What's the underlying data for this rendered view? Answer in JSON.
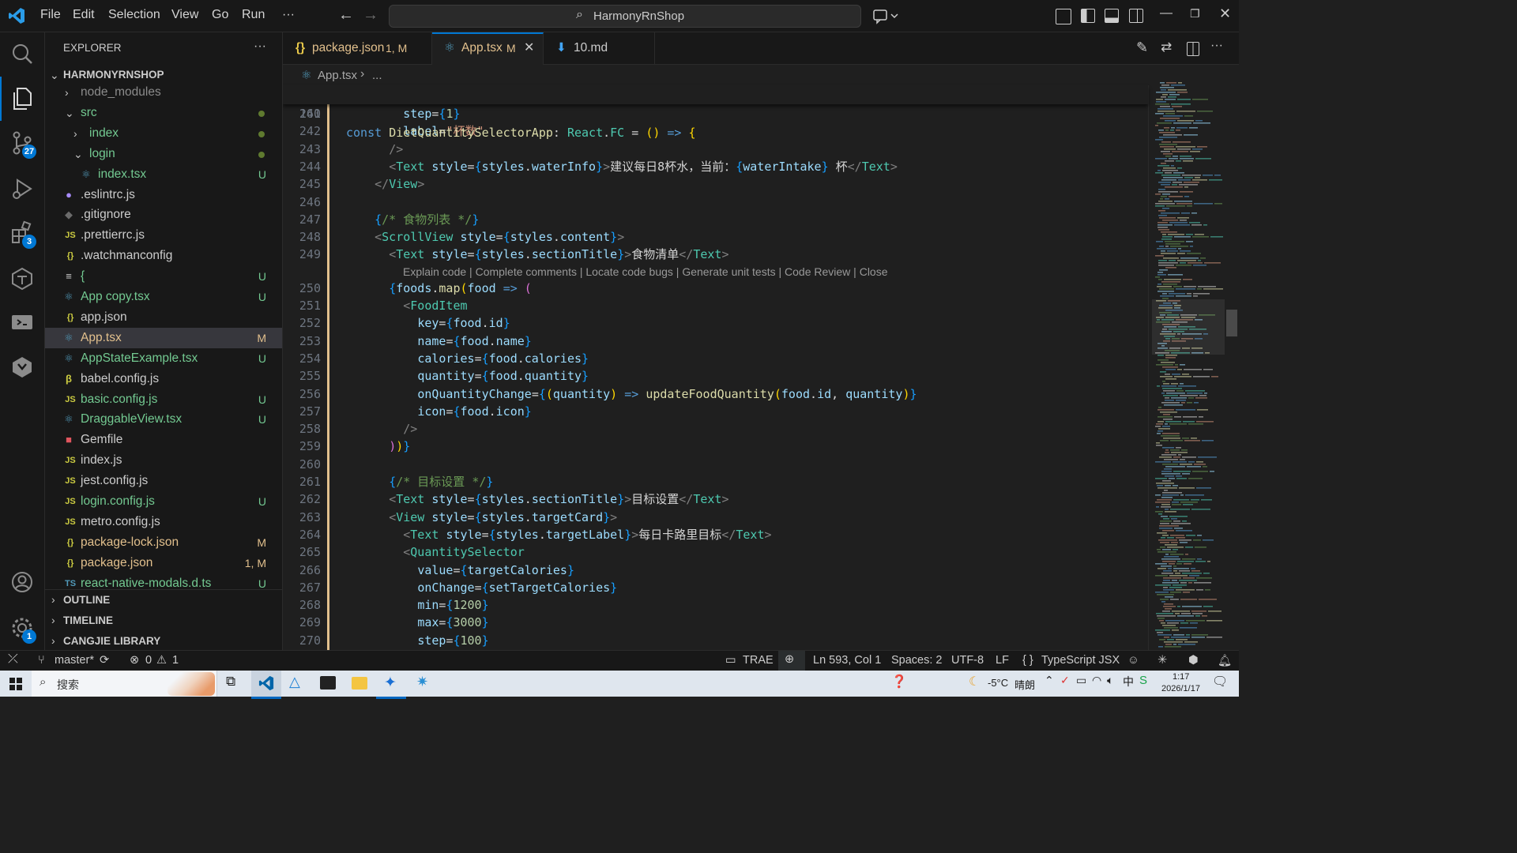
{
  "titlebar": {
    "menus": [
      "File",
      "Edit",
      "Selection",
      "View",
      "Go",
      "Run",
      "···"
    ],
    "search": "HarmonyRnShop"
  },
  "activity": {
    "items": [
      "files-icon",
      "search-icon",
      "source-control-icon",
      "run-debug-icon",
      "extensions-icon",
      "trae-icon",
      "remote-icon",
      "harmony-icon"
    ],
    "scm_badge": "27",
    "ext_badge": "3",
    "settings_badge": "1"
  },
  "sidebar": {
    "title": "EXPLORER",
    "more": "···",
    "root": "HARMONYRNSHOP",
    "rows": [
      {
        "name": "node_modules",
        "type": "folder-closed",
        "indent": 1,
        "color": "#8b8b8b",
        "status": "",
        "dot": false
      },
      {
        "name": "src",
        "type": "folder-open",
        "indent": 1,
        "color": "#73c991",
        "status": "",
        "dot": true
      },
      {
        "name": "index",
        "type": "folder-closed",
        "indent": 2,
        "color": "#73c991",
        "status": "",
        "dot": true
      },
      {
        "name": "login",
        "type": "folder-open",
        "indent": 2,
        "color": "#73c991",
        "status": "",
        "dot": true
      },
      {
        "name": "index.tsx",
        "type": "react",
        "indent": 3,
        "color": "#73c991",
        "status": "U",
        "dot": false
      },
      {
        "name": ".eslintrc.js",
        "type": "eslint",
        "indent": 1,
        "color": "#cccccc",
        "status": "",
        "dot": false
      },
      {
        "name": ".gitignore",
        "type": "git",
        "indent": 1,
        "color": "#cccccc",
        "status": "",
        "dot": false
      },
      {
        "name": ".prettierrc.js",
        "type": "js",
        "indent": 1,
        "color": "#cccccc",
        "status": "",
        "dot": false
      },
      {
        "name": ".watchmanconfig",
        "type": "json",
        "indent": 1,
        "color": "#cccccc",
        "status": "",
        "dot": false
      },
      {
        "name": "{",
        "type": "text",
        "indent": 1,
        "color": "#73c991",
        "status": "U",
        "dot": false
      },
      {
        "name": "App copy.tsx",
        "type": "react",
        "indent": 1,
        "color": "#73c991",
        "status": "U",
        "dot": false
      },
      {
        "name": "app.json",
        "type": "json",
        "indent": 1,
        "color": "#cccccc",
        "status": "",
        "dot": false
      },
      {
        "name": "App.tsx",
        "type": "react",
        "indent": 1,
        "color": "#e2c08d",
        "status": "M",
        "dot": false,
        "selected": true
      },
      {
        "name": "AppStateExample.tsx",
        "type": "react",
        "indent": 1,
        "color": "#73c991",
        "status": "U",
        "dot": false
      },
      {
        "name": "babel.config.js",
        "type": "babel",
        "indent": 1,
        "color": "#cccccc",
        "status": "",
        "dot": false
      },
      {
        "name": "basic.config.js",
        "type": "js",
        "indent": 1,
        "color": "#73c991",
        "status": "U",
        "dot": false
      },
      {
        "name": "DraggableView.tsx",
        "type": "react",
        "indent": 1,
        "color": "#73c991",
        "status": "U",
        "dot": false
      },
      {
        "name": "Gemfile",
        "type": "ruby",
        "indent": 1,
        "color": "#cccccc",
        "status": "",
        "dot": false
      },
      {
        "name": "index.js",
        "type": "js",
        "indent": 1,
        "color": "#cccccc",
        "status": "",
        "dot": false
      },
      {
        "name": "jest.config.js",
        "type": "js",
        "indent": 1,
        "color": "#cccccc",
        "status": "",
        "dot": false
      },
      {
        "name": "login.config.js",
        "type": "js",
        "indent": 1,
        "color": "#73c991",
        "status": "U",
        "dot": false
      },
      {
        "name": "metro.config.js",
        "type": "js",
        "indent": 1,
        "color": "#cccccc",
        "status": "",
        "dot": false
      },
      {
        "name": "package-lock.json",
        "type": "json",
        "indent": 1,
        "color": "#e2c08d",
        "status": "M",
        "dot": false
      },
      {
        "name": "package.json",
        "type": "json",
        "indent": 1,
        "color": "#e2c08d",
        "status": "1, M",
        "dot": false
      },
      {
        "name": "react-native-modals.d.ts",
        "type": "ts",
        "indent": 1,
        "color": "#73c991",
        "status": "U",
        "dot": false
      }
    ],
    "sections": [
      "OUTLINE",
      "TIMELINE",
      "CANGJIE LIBRARY"
    ]
  },
  "tabs": [
    {
      "icon": "{}",
      "label": "package.json",
      "suffix": "1, M",
      "active": false,
      "color": "#e2c08d"
    },
    {
      "icon": "⚛",
      "label": "App.tsx",
      "suffix": "M",
      "active": true,
      "color": "#e2c08d"
    },
    {
      "icon": "⬇",
      "label": "10.md",
      "suffix": "",
      "active": false,
      "color": "#cccccc"
    }
  ],
  "breadcrumb": {
    "file": "App.tsx",
    "rest": "..."
  },
  "sticky": {
    "line": "160",
    "code": "const DietQuantitySelectorApp: React.FC = () => {"
  },
  "codelens": "Explain code | Complete comments | Locate code bugs | Generate unit tests | Code Review | Close",
  "code_lines": [
    {
      "n": "241",
      "html": "        <span class='p'>step</span><span class='tx'>=</span><span class='b3'>{</span><span class='n'>1</span><span class='b3'>}</span>"
    },
    {
      "n": "242",
      "html": "        <span class='p'>label</span><span class='tx'>=</span><span class='s'>\"杯数\"</span>"
    },
    {
      "n": "243",
      "html": "      <span class='tg'>/&gt;</span>"
    },
    {
      "n": "244",
      "html": "      <span class='tg'>&lt;</span><span class='tn'>Text</span> <span class='p'>style</span><span class='tx'>=</span><span class='b3'>{</span><span class='p'>styles</span><span class='tx'>.</span><span class='p'>waterInfo</span><span class='b3'>}</span><span class='tg'>&gt;</span><span class='tx'>建议每日8杯水，当前：</span><span class='b3'>{</span><span class='p'>waterIntake</span><span class='b3'>}</span><span class='tx'> 杯</span><span class='tg'>&lt;/</span><span class='tn'>Text</span><span class='tg'>&gt;</span>"
    },
    {
      "n": "245",
      "html": "    <span class='tg'>&lt;/</span><span class='tn'>View</span><span class='tg'>&gt;</span>"
    },
    {
      "n": "246",
      "html": ""
    },
    {
      "n": "247",
      "html": "    <span class='b3'>{</span><span class='c'>/* 食物列表 */</span><span class='b3'>}</span>"
    },
    {
      "n": "248",
      "html": "    <span class='tg'>&lt;</span><span class='tn'>ScrollView</span> <span class='p'>style</span><span class='tx'>=</span><span class='b3'>{</span><span class='p'>styles</span><span class='tx'>.</span><span class='p'>content</span><span class='b3'>}</span><span class='tg'>&gt;</span>"
    },
    {
      "n": "249",
      "html": "      <span class='tg'>&lt;</span><span class='tn'>Text</span> <span class='p'>style</span><span class='tx'>=</span><span class='b3'>{</span><span class='p'>styles</span><span class='tx'>.</span><span class='p'>sectionTitle</span><span class='b3'>}</span><span class='tg'>&gt;</span><span class='tx'>食物清单</span><span class='tg'>&lt;/</span><span class='tn'>Text</span><span class='tg'>&gt;</span>"
    },
    {
      "n": "250",
      "html": "      <span class='b3'>{</span><span class='p'>foods</span><span class='tx'>.</span><span class='f'>map</span><span class='b1'>(</span><span class='p'>food</span> <span class='k'>=&gt;</span> <span class='b2'>(</span>"
    },
    {
      "n": "251",
      "html": "        <span class='tg'>&lt;</span><span class='tn'>FoodItem</span>"
    },
    {
      "n": "252",
      "html": "          <span class='p'>key</span><span class='tx'>=</span><span class='b3'>{</span><span class='p'>food</span><span class='tx'>.</span><span class='p'>id</span><span class='b3'>}</span>"
    },
    {
      "n": "253",
      "html": "          <span class='p'>name</span><span class='tx'>=</span><span class='b3'>{</span><span class='p'>food</span><span class='tx'>.</span><span class='p'>name</span><span class='b3'>}</span>"
    },
    {
      "n": "254",
      "html": "          <span class='p'>calories</span><span class='tx'>=</span><span class='b3'>{</span><span class='p'>food</span><span class='tx'>.</span><span class='p'>calories</span><span class='b3'>}</span>"
    },
    {
      "n": "255",
      "html": "          <span class='p'>quantity</span><span class='tx'>=</span><span class='b3'>{</span><span class='p'>food</span><span class='tx'>.</span><span class='p'>quantity</span><span class='b3'>}</span>"
    },
    {
      "n": "256",
      "html": "          <span class='p'>onQuantityChange</span><span class='tx'>=</span><span class='b3'>{</span><span class='b1'>(</span><span class='p'>quantity</span><span class='b1'>)</span> <span class='k'>=&gt;</span> <span class='f'>updateFoodQuantity</span><span class='b1'>(</span><span class='p'>food</span><span class='tx'>.</span><span class='p'>id</span><span class='tx'>, </span><span class='p'>quantity</span><span class='b1'>)</span><span class='b3'>}</span>"
    },
    {
      "n": "257",
      "html": "          <span class='p'>icon</span><span class='tx'>=</span><span class='b3'>{</span><span class='p'>food</span><span class='tx'>.</span><span class='p'>icon</span><span class='b3'>}</span>"
    },
    {
      "n": "258",
      "html": "        <span class='tg'>/&gt;</span>"
    },
    {
      "n": "259",
      "html": "      <span class='b2'>)</span><span class='b1'>)</span><span class='b3'>}</span>"
    },
    {
      "n": "260",
      "html": ""
    },
    {
      "n": "261",
      "html": "      <span class='b3'>{</span><span class='c'>/* 目标设置 */</span><span class='b3'>}</span>"
    },
    {
      "n": "262",
      "html": "      <span class='tg'>&lt;</span><span class='tn'>Text</span> <span class='p'>style</span><span class='tx'>=</span><span class='b3'>{</span><span class='p'>styles</span><span class='tx'>.</span><span class='p'>sectionTitle</span><span class='b3'>}</span><span class='tg'>&gt;</span><span class='tx'>目标设置</span><span class='tg'>&lt;/</span><span class='tn'>Text</span><span class='tg'>&gt;</span>"
    },
    {
      "n": "263",
      "html": "      <span class='tg'>&lt;</span><span class='tn'>View</span> <span class='p'>style</span><span class='tx'>=</span><span class='b3'>{</span><span class='p'>styles</span><span class='tx'>.</span><span class='p'>targetCard</span><span class='b3'>}</span><span class='tg'>&gt;</span>"
    },
    {
      "n": "264",
      "html": "        <span class='tg'>&lt;</span><span class='tn'>Text</span> <span class='p'>style</span><span class='tx'>=</span><span class='b3'>{</span><span class='p'>styles</span><span class='tx'>.</span><span class='p'>targetLabel</span><span class='b3'>}</span><span class='tg'>&gt;</span><span class='tx'>每日卡路里目标</span><span class='tg'>&lt;/</span><span class='tn'>Text</span><span class='tg'>&gt;</span>"
    },
    {
      "n": "265",
      "html": "        <span class='tg'>&lt;</span><span class='tn'>QuantitySelector</span>"
    },
    {
      "n": "266",
      "html": "          <span class='p'>value</span><span class='tx'>=</span><span class='b3'>{</span><span class='p'>targetCalories</span><span class='b3'>}</span>"
    },
    {
      "n": "267",
      "html": "          <span class='p'>onChange</span><span class='tx'>=</span><span class='b3'>{</span><span class='p'>setTargetCalories</span><span class='b3'>}</span>"
    },
    {
      "n": "268",
      "html": "          <span class='p'>min</span><span class='tx'>=</span><span class='b3'>{</span><span class='n'>1200</span><span class='b3'>}</span>"
    },
    {
      "n": "269",
      "html": "          <span class='p'>max</span><span class='tx'>=</span><span class='b3'>{</span><span class='n'>3000</span><span class='b3'>}</span>"
    },
    {
      "n": "270",
      "html": "          <span class='p'>step</span><span class='tx'>=</span><span class='b3'>{</span><span class='n'>100</span><span class='b3'>}</span>"
    }
  ],
  "status": {
    "branch": "master*",
    "errors": "0",
    "warnings": "1",
    "trae": "TRAE",
    "position": "Ln 593, Col 1",
    "spaces": "Spaces: 2",
    "encoding": "UTF-8",
    "eol": "LF",
    "language": "TypeScript JSX"
  },
  "taskbar": {
    "search_placeholder": "搜索",
    "weather_temp": "-5°C",
    "weather_desc": "晴朗",
    "time": "1:17",
    "date": "2026/1/17"
  }
}
